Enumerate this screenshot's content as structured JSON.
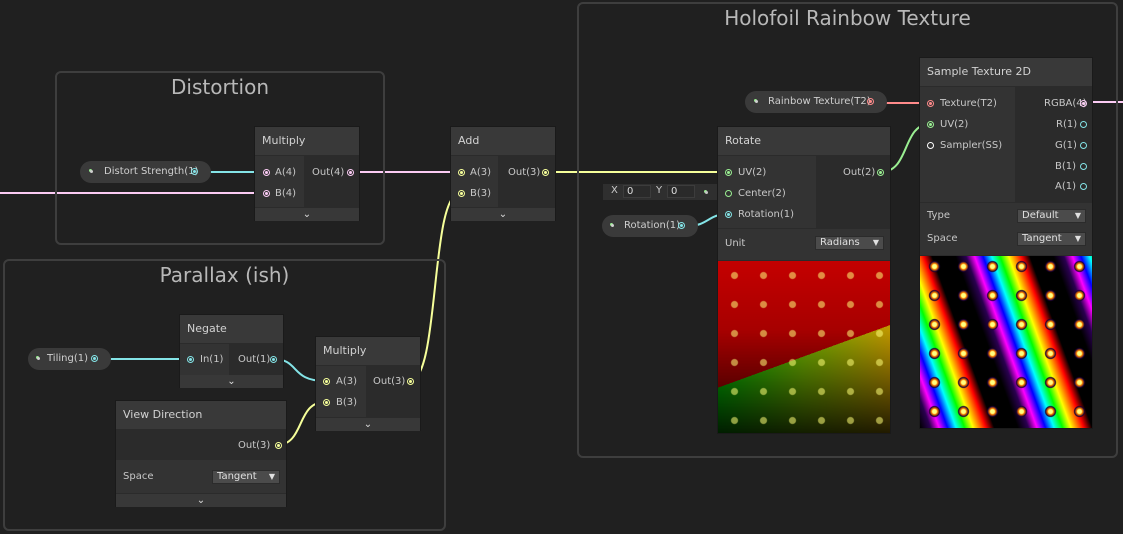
{
  "groups": {
    "distortion": "Distortion",
    "parallax": "Parallax (ish)",
    "holofoil": "Holofoil Rainbow Texture"
  },
  "properties": {
    "distort_strength": "Distort Strength(1)",
    "tiling": "Tiling(1)",
    "rotation": "Rotation(1)",
    "rainbow_texture": "Rainbow Texture(T2)"
  },
  "nodes": {
    "multiply_distort": {
      "title": "Multiply",
      "in_a": "A(4)",
      "in_b": "B(4)",
      "out": "Out(4)"
    },
    "add": {
      "title": "Add",
      "in_a": "A(3)",
      "in_b": "B(3)",
      "out": "Out(3)"
    },
    "negate": {
      "title": "Negate",
      "in": "In(1)",
      "out": "Out(1)"
    },
    "multiply_parallax": {
      "title": "Multiply",
      "in_a": "A(3)",
      "in_b": "B(3)",
      "out": "Out(3)"
    },
    "view_direction": {
      "title": "View Direction",
      "out": "Out(3)",
      "space_label": "Space",
      "space_value": "Tangent"
    },
    "rotate": {
      "title": "Rotate",
      "in_uv": "UV(2)",
      "in_center": "Center(2)",
      "in_rotation": "Rotation(1)",
      "out": "Out(2)",
      "unit_label": "Unit",
      "unit_value": "Radians",
      "center_x_label": "X",
      "center_x": "0",
      "center_y_label": "Y",
      "center_y": "0"
    },
    "sample_texture": {
      "title": "Sample Texture 2D",
      "in_texture": "Texture(T2)",
      "in_uv": "UV(2)",
      "in_sampler": "Sampler(SS)",
      "out_rgba": "RGBA(4)",
      "out_r": "R(1)",
      "out_g": "G(1)",
      "out_b": "B(1)",
      "out_a": "A(1)",
      "type_label": "Type",
      "type_value": "Default",
      "space_label": "Space",
      "space_value": "Tangent"
    }
  },
  "colors": {
    "vec1": "#84e4e7",
    "vec2": "#9aef92",
    "vec3": "#f6ff9a",
    "vec4": "#fbcbf4",
    "texture": "#ff8b8b",
    "background": "#202020"
  },
  "icons": {
    "collapse": "chevron-down-icon",
    "dropdown": "triangle-down-icon"
  }
}
